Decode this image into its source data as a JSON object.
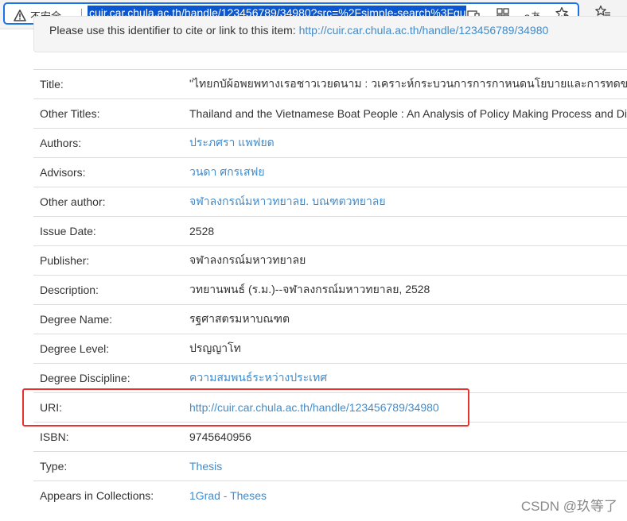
{
  "browser": {
    "security_label": "不安全",
    "url": "cuir.car.chula.ac.th/handle/123456789/34980?src=%2Fsimple-search%3Fquery",
    "icons": [
      "device-icon",
      "apps-icon",
      "read-aloud-icon",
      "add-favorite-icon",
      "favorites-icon"
    ],
    "read_aloud_glyph": "aあ",
    "accent": "#1a73e8"
  },
  "cite": {
    "text": "Please use this identifier to cite or link to this item: ",
    "link": "http://cuir.car.chula.ac.th/handle/123456789/34980"
  },
  "rows": [
    {
      "label": "Title:",
      "value": "\"ไทยกบัผ้อพยพทางเรอชาวเวยดนาม : วเคราะห์กระบวนการการกาหนดนโยบายและการทดของไทย",
      "link": false
    },
    {
      "label": "Other Titles:",
      "value": "Thailand and the Vietnamese Boat People : An Analysis of Policy Making Process and Di",
      "link": false
    },
    {
      "label": "Authors:",
      "value": "ประภศรา แพฟยด",
      "link": true
    },
    {
      "label": "Advisors:",
      "value": "วนดา ศกรเสฟย",
      "link": true
    },
    {
      "label": "Other author:",
      "value": "จฬาลงกรณ์มหาวทยาลย. บณฑตวทยาลย",
      "link": true
    },
    {
      "label": "Issue Date:",
      "value": "2528",
      "link": false
    },
    {
      "label": "Publisher:",
      "value": "จฬาลงกรณ์มหาวทยาลย",
      "link": false
    },
    {
      "label": "Description:",
      "value": "วทยานพนธ์ (ร.ม.)--จฬาลงกรณ์มหาวทยาลย, 2528",
      "link": false
    },
    {
      "label": "Degree Name:",
      "value": "รฐศาสตรมหาบณฑต",
      "link": false
    },
    {
      "label": "Degree Level:",
      "value": "ปรญญาโท",
      "link": false
    },
    {
      "label": "Degree Discipline:",
      "value": "ความสมพนธ์ระหว่างประเทศ",
      "link": true
    },
    {
      "label": "URI:",
      "value": "http://cuir.car.chula.ac.th/handle/123456789/34980",
      "link": true
    },
    {
      "label": "ISBN:",
      "value": "9745640956",
      "link": false
    },
    {
      "label": "Type:",
      "value": "Thesis",
      "link": true
    },
    {
      "label": "Appears in Collections:",
      "value": "1Grad - Theses",
      "link": true
    }
  ],
  "watermark": "CSDN @玖等了",
  "colors": {
    "link": "#428bca",
    "highlight_box": "#e8322e"
  }
}
